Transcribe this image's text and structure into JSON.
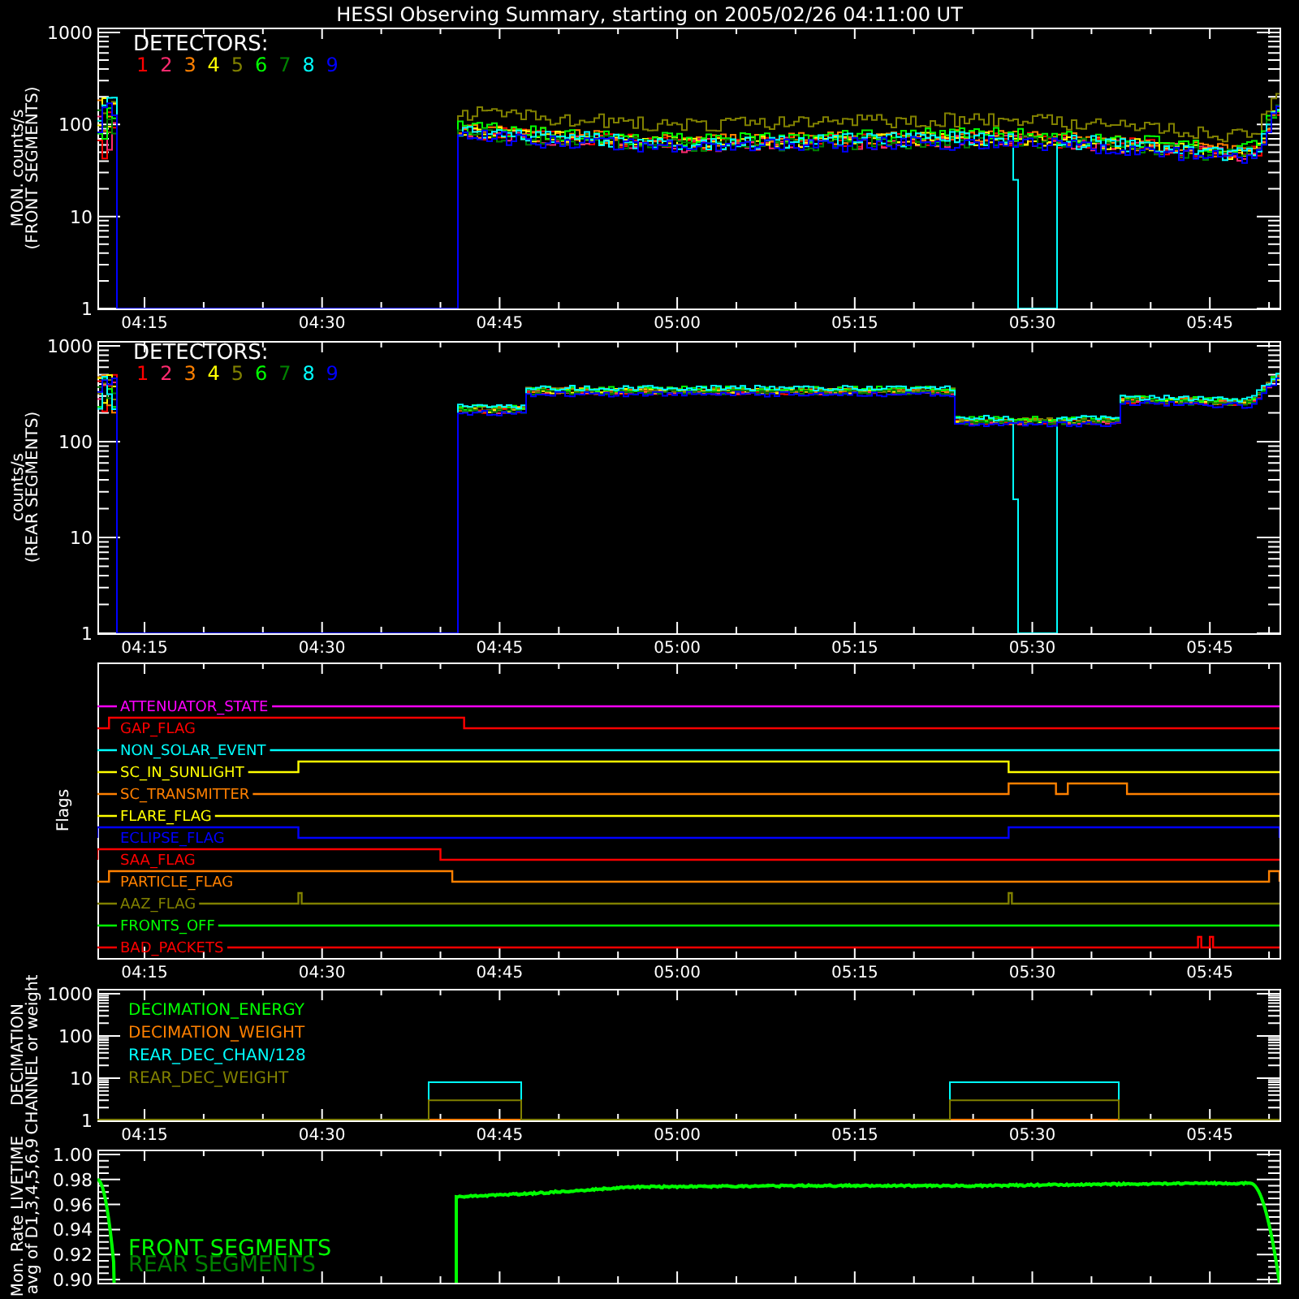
{
  "title": "HESSI Observing Summary, starting on 2005/02/26 04:11:00 UT",
  "panels": [
    {
      "kind": "counts",
      "ylabel": [
        "MON. counts/s",
        "(FRONT SEGMENTS)"
      ],
      "yticks": [
        "1000",
        "100",
        "10",
        "1"
      ],
      "legend_title": "DETECTORS:",
      "detectors": [
        {
          "label": "1",
          "color": "#ff0000"
        },
        {
          "label": "2",
          "color": "#ff2a6e"
        },
        {
          "label": "3",
          "color": "#ff8000"
        },
        {
          "label": "4",
          "color": "#ffff00"
        },
        {
          "label": "5",
          "color": "#808000"
        },
        {
          "label": "6",
          "color": "#00ff00"
        },
        {
          "label": "7",
          "color": "#008000"
        },
        {
          "label": "8",
          "color": "#00ffff"
        },
        {
          "label": "9",
          "color": "#0000ff"
        }
      ],
      "xticks": [
        "04:15",
        "04:30",
        "04:45",
        "05:00",
        "05:15",
        "05:30",
        "05:45"
      ]
    },
    {
      "kind": "counts",
      "ylabel": [
        "counts/s",
        "(REAR SEGMENTS)"
      ],
      "yticks": [
        "1000",
        "100",
        "10",
        "1"
      ],
      "legend_title": "DETECTORS:",
      "detectors": [
        {
          "label": "1",
          "color": "#ff0000"
        },
        {
          "label": "2",
          "color": "#ff2a6e"
        },
        {
          "label": "3",
          "color": "#ff8000"
        },
        {
          "label": "4",
          "color": "#ffff00"
        },
        {
          "label": "5",
          "color": "#808000"
        },
        {
          "label": "6",
          "color": "#00ff00"
        },
        {
          "label": "7",
          "color": "#008000"
        },
        {
          "label": "8",
          "color": "#00ffff"
        },
        {
          "label": "9",
          "color": "#0000ff"
        }
      ],
      "xticks": [
        "04:15",
        "04:30",
        "04:45",
        "05:00",
        "05:15",
        "05:30",
        "05:45"
      ]
    },
    {
      "kind": "flags",
      "ylabel": [
        "Flags"
      ],
      "flags": [
        {
          "label": "ATTENUATOR_STATE",
          "color": "#ff00ff"
        },
        {
          "label": "GAP_FLAG",
          "color": "#ff0000"
        },
        {
          "label": "NON_SOLAR_EVENT",
          "color": "#00ffff"
        },
        {
          "label": "SC_IN_SUNLIGHT",
          "color": "#ffff00"
        },
        {
          "label": "SC_TRANSMITTER",
          "color": "#ff8000"
        },
        {
          "label": "FLARE_FLAG",
          "color": "#ffff00"
        },
        {
          "label": "ECLIPSE_FLAG",
          "color": "#0000ff"
        },
        {
          "label": "SAA_FLAG",
          "color": "#ff0000"
        },
        {
          "label": "PARTICLE_FLAG",
          "color": "#ff8000"
        },
        {
          "label": "AAZ_FLAG",
          "color": "#808000"
        },
        {
          "label": "FRONTS_OFF",
          "color": "#00ff00"
        },
        {
          "label": "BAD_PACKETS",
          "color": "#ff0000"
        }
      ],
      "xticks": [
        "04:15",
        "04:30",
        "04:45",
        "05:00",
        "05:15",
        "05:30",
        "05:45"
      ]
    },
    {
      "kind": "decimation",
      "ylabel": [
        "DECIMATION",
        "CHANNEL or weight"
      ],
      "yticks": [
        "1000",
        "100",
        "10",
        "1"
      ],
      "legend": [
        {
          "label": "DECIMATION_ENERGY",
          "color": "#00ff00"
        },
        {
          "label": "DECIMATION_WEIGHT",
          "color": "#ff8000"
        },
        {
          "label": "REAR_DEC_CHAN/128",
          "color": "#00ffff"
        },
        {
          "label": "REAR_DEC_WEIGHT",
          "color": "#808000"
        }
      ],
      "xticks": [
        "04:15",
        "04:30",
        "04:45",
        "05:00",
        "05:15",
        "05:30",
        "05:45"
      ]
    },
    {
      "kind": "livetime",
      "ylabel": [
        "Mon. Rate LIVETIME",
        "avg of D1,3,4,5,6,9"
      ],
      "yticks": [
        "1.00",
        "0.98",
        "0.96",
        "0.94",
        "0.92",
        "0.90"
      ],
      "legend": [
        {
          "label": "FRONT SEGMENTS",
          "color": "#00ff00"
        },
        {
          "label": "REAR SEGMENTS",
          "color": "#008000"
        }
      ]
    }
  ]
}
